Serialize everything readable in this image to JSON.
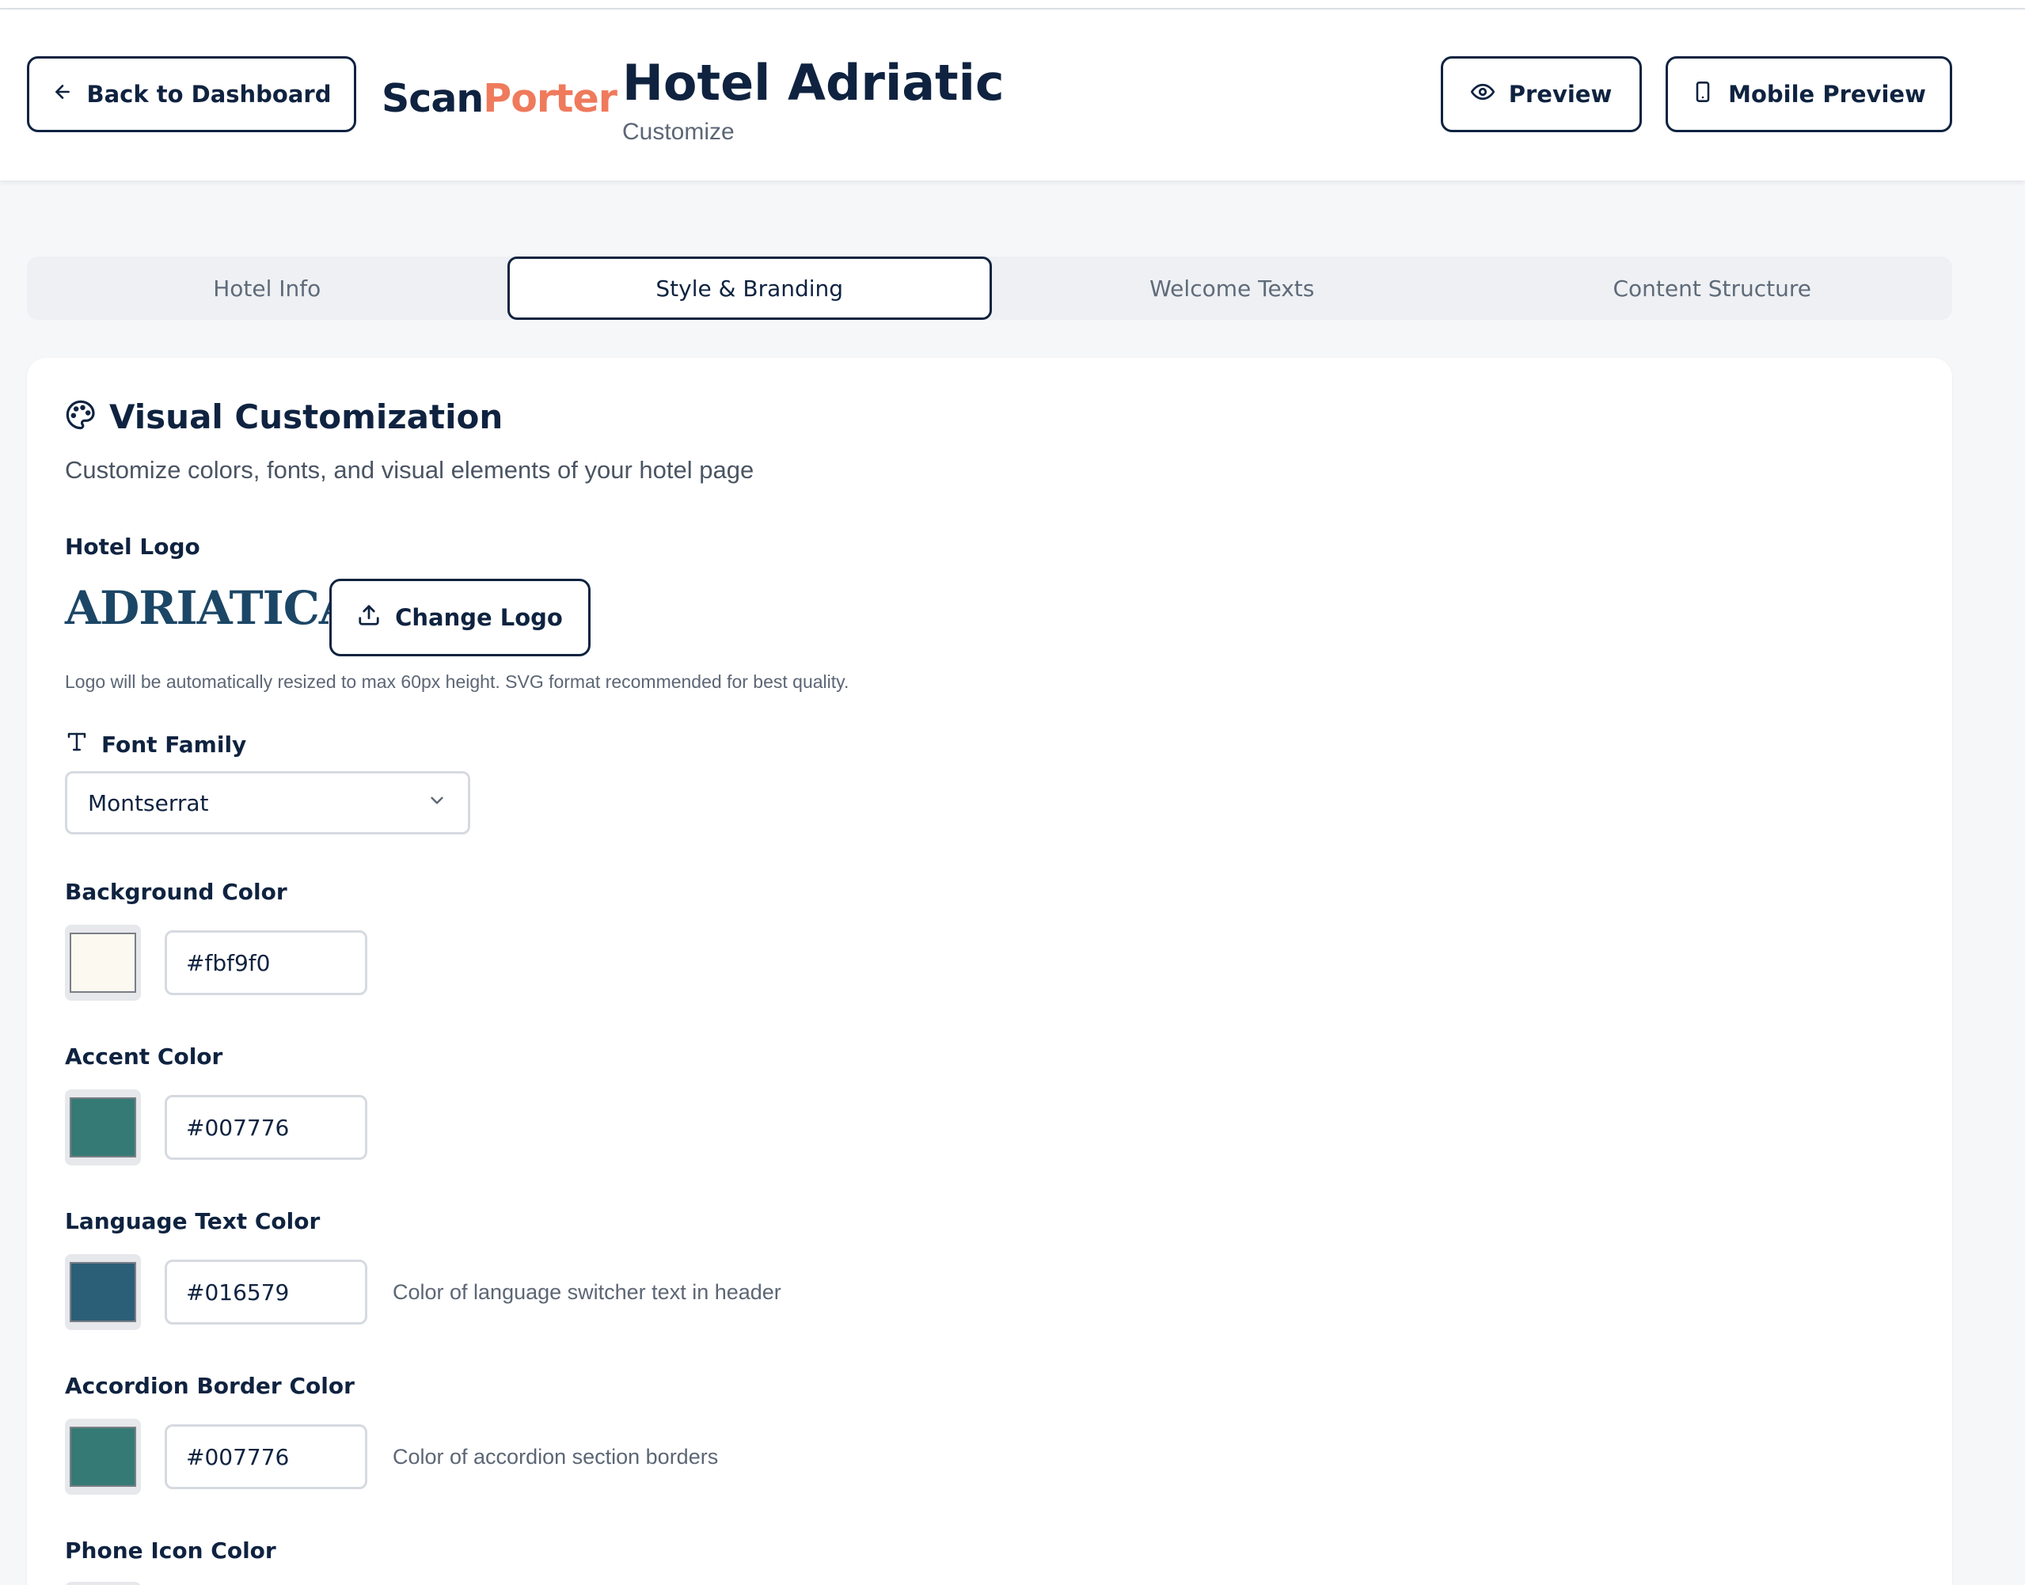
{
  "header": {
    "back_label": "Back to Dashboard",
    "brand_scan": "Scan",
    "brand_porter": "Porter",
    "hotel_name": "Hotel Adriatic",
    "subtitle": "Customize",
    "preview_label": "Preview",
    "mobile_preview_label": "Mobile Preview"
  },
  "tabs": [
    {
      "label": "Hotel Info",
      "active": false
    },
    {
      "label": "Style & Branding",
      "active": true
    },
    {
      "label": "Welcome Texts",
      "active": false
    },
    {
      "label": "Content Structure",
      "active": false
    }
  ],
  "section": {
    "title": "Visual Customization",
    "description": "Customize colors, fonts, and visual elements of your hotel page"
  },
  "logo": {
    "label": "Hotel Logo",
    "logo_text": "ADRIATICA",
    "change_label": "Change Logo",
    "hint": "Logo will be automatically resized to max 60px height. SVG format recommended for best quality."
  },
  "font": {
    "label": "Font Family",
    "value": "Montserrat"
  },
  "colors": {
    "background": {
      "label": "Background Color",
      "value": "#fbf9f0",
      "hint": ""
    },
    "accent": {
      "label": "Accent Color",
      "value": "#007776",
      "hint": ""
    },
    "language_text": {
      "label": "Language Text Color",
      "value": "#016579",
      "hint": "Color of language switcher text in header"
    },
    "accordion_border": {
      "label": "Accordion Border Color",
      "value": "#007776",
      "hint": "Color of accordion section borders"
    },
    "phone_icon": {
      "label": "Phone Icon Color"
    }
  },
  "theme": {
    "navy": "#0f2340",
    "brand_orange": "#ef7a5c",
    "swatch_background": "#fbf9f0",
    "swatch_accent": "#357a75",
    "swatch_language": "#2b5e77",
    "swatch_accordion": "#357a75"
  }
}
